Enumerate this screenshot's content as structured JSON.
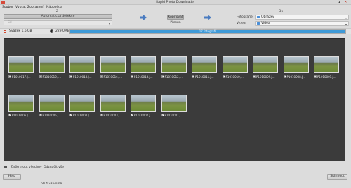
{
  "window": {
    "title": "Rapid Photo Downloader"
  },
  "menu": {
    "items": [
      "Soubor",
      "Vybrat",
      "Zobrazení",
      "Nápověda"
    ]
  },
  "source": {
    "header": "Z",
    "auto_button": "Automatická detekce",
    "combo_text": "Cíl"
  },
  "transfer": {
    "copy_label": "Kopírovat",
    "move_label": "Přesun"
  },
  "destination": {
    "header": "Do",
    "photos_label": "Fotografie:",
    "photos_value": "Obrázky",
    "videos_label": "Videa:",
    "videos_value": "Videa"
  },
  "device": {
    "name": "Svazek 1,6 GB",
    "size": "229.0MB",
    "progress_text": "17 fotografií",
    "progress": 1.0
  },
  "thumbnails": [
    "P1010017.J...",
    "P1010016.J...",
    "P1010015.J...",
    "P1010014.J...",
    "P1010013.J...",
    "P1010012.J...",
    "P1010011.J...",
    "P1010010.J...",
    "P1010009.J...",
    "P1010008.J...",
    "P1010007.J...",
    "P1010006.J...",
    "P1010005.J...",
    "P1010004.J...",
    "P1010003.J...",
    "P1010002.J...",
    "P1010001.J..."
  ],
  "bottom": {
    "select_all": "Zaškrtnout všechny",
    "deselect_all": "Odznačit vše"
  },
  "buttons": {
    "help": "Help",
    "download": "Stáhnout"
  },
  "status": {
    "text": "60.4GB volné"
  },
  "colors": {
    "progress": "#3f9ad7",
    "grid_bg": "#3b3b3b",
    "app_icon": "#d64a3a",
    "folder": "#4a8fd8"
  }
}
